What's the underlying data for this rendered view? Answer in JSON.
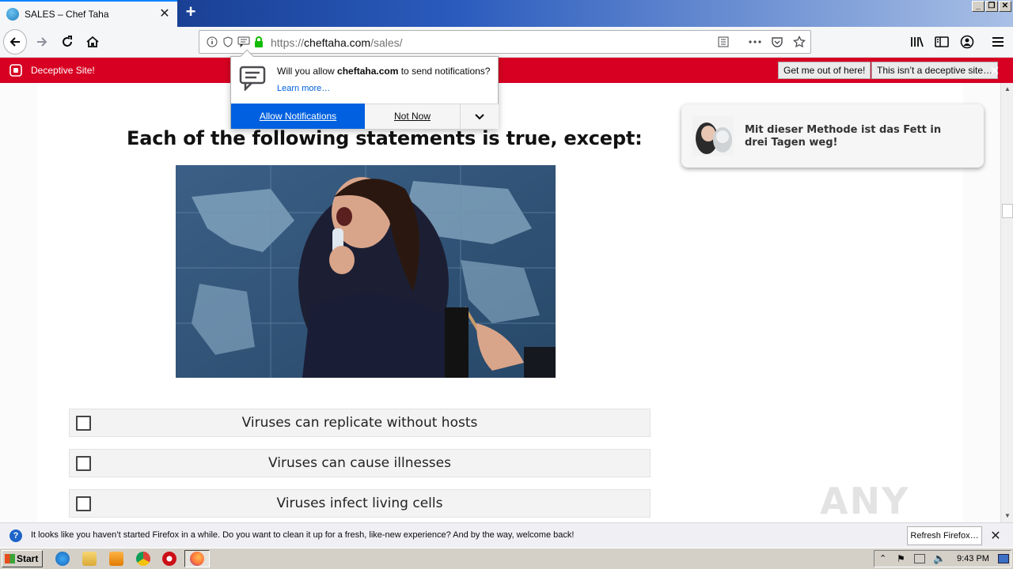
{
  "tab": {
    "title": "SALES – Chef Taha",
    "close": "✕",
    "new": "+"
  },
  "window": {
    "minimize": "_",
    "restore": "❐",
    "close": "✕"
  },
  "url": {
    "prefix": "https://",
    "host": "cheftaha.com",
    "path": "/sales/"
  },
  "deceptive": {
    "label": "Deceptive Site!",
    "get_out": "Get me out of here!",
    "not_deceptive": "This isn’t a deceptive site…",
    "close": "✕"
  },
  "popup": {
    "msg_pre": "Will you allow ",
    "msg_host": "cheftaha.com",
    "msg_post": " to send notifications?",
    "learn_more": "Learn more…",
    "allow": "Allow Notifications",
    "not_now": "Not Now"
  },
  "page": {
    "question": "Each of the following statements is true, except:",
    "options": [
      "Viruses can replicate without hosts",
      "Viruses can cause illnesses",
      "Viruses infect living cells"
    ],
    "ad_text": "Mit dieser Methode ist das Fett in drei Tagen weg!",
    "watermark": "ANY RUN"
  },
  "notification": {
    "text": "It looks like you haven’t started Firefox in a while. Do you want to clean it up for a fresh, like-new experience? And by the way, welcome back!",
    "button": "Refresh Firefox…",
    "close": "✕",
    "icon": "?"
  },
  "taskbar": {
    "start": "Start",
    "clock": "9:43 PM"
  },
  "colors": {
    "deceptive_red": "#d70022",
    "allow_blue": "#0060df",
    "title_gradient_start": "#0f2f7a"
  }
}
